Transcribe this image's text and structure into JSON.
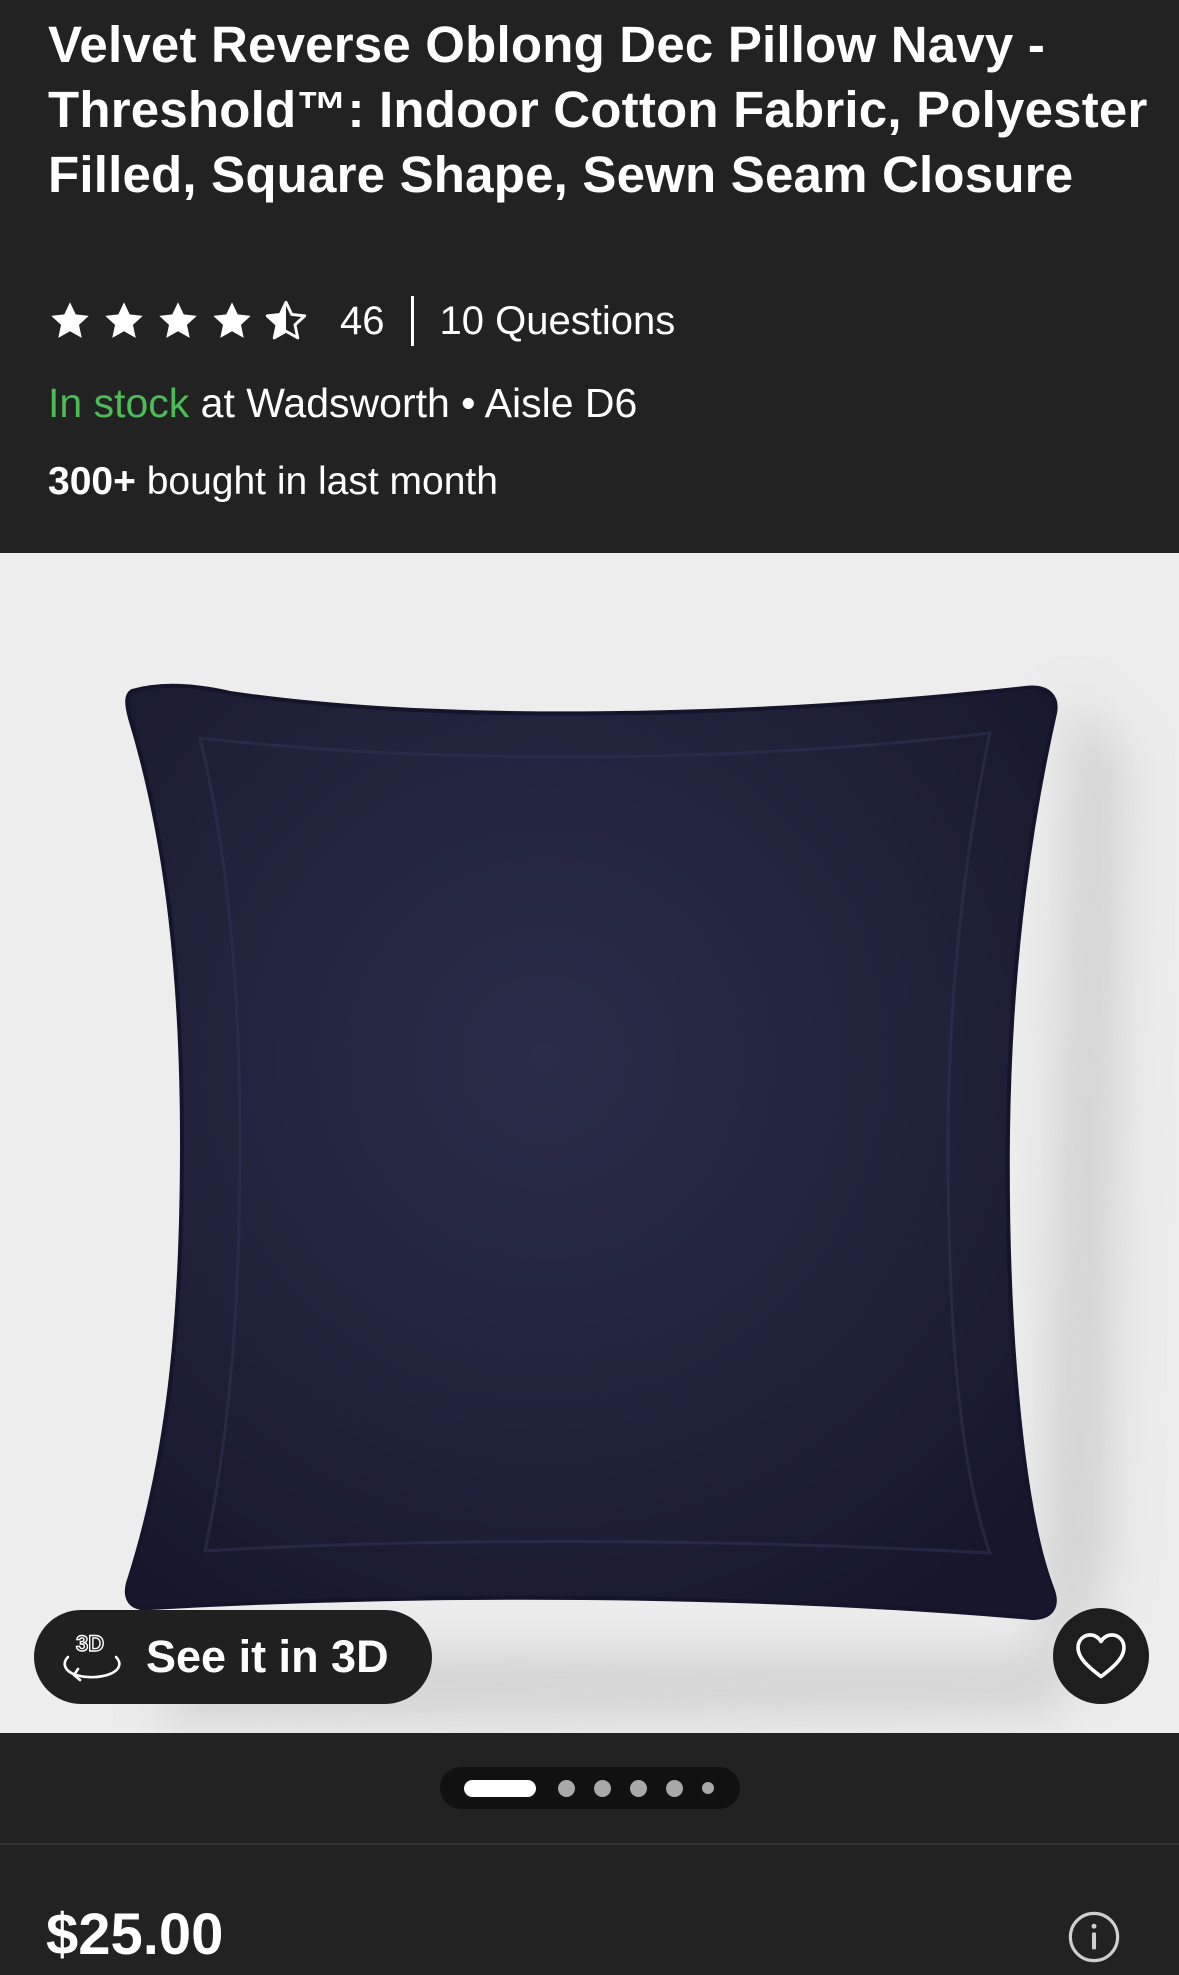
{
  "product": {
    "title": "Velvet Reverse Oblong Dec Pillow Navy - Threshold™: Indoor Cotton Fabric, Polyester Filled, Square Shape, Sewn Seam Closure",
    "rating": 4.5,
    "rating_max": 5,
    "review_count": "46",
    "questions_label": "10 Questions",
    "stock_status": "In stock",
    "stock_location": " at Wadsworth • Aisle D6",
    "bought_count": "300+",
    "bought_label": " bought in last month",
    "price": "$25.00"
  },
  "media": {
    "see_3d_label": "See it in 3D",
    "carousel_total": 6,
    "carousel_active_index": 0
  },
  "icons": {
    "star": "star-icon",
    "half_star": "star-half-icon",
    "view_3d": "3d-rotate-icon",
    "favorite": "heart-icon",
    "info": "info-icon"
  },
  "colors": {
    "background": "#222222",
    "in_stock_green": "#4cbc56",
    "image_background": "#ededed",
    "pillow_navy": "#1f2138"
  }
}
